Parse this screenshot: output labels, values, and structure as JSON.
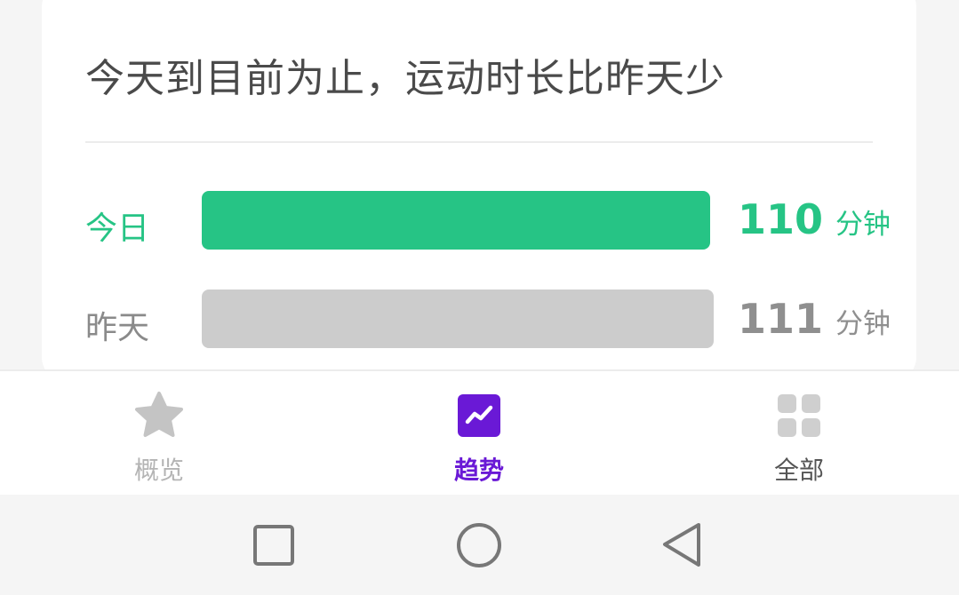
{
  "card": {
    "headline": "今天到目前为止，运动时长比昨天少",
    "rows": [
      {
        "label": "今日",
        "value": "110",
        "unit": "分钟",
        "color": "#26c485"
      },
      {
        "label": "昨天",
        "value": "111",
        "unit": "分钟",
        "color": "#cccccc"
      }
    ]
  },
  "tabbar": {
    "tabs": [
      {
        "label": "概览",
        "icon": "star-icon",
        "active": false
      },
      {
        "label": "趋势",
        "icon": "trend-icon",
        "active": true
      },
      {
        "label": "全部",
        "icon": "grid-icon",
        "active": false
      }
    ],
    "active_color": "#6a19d6"
  },
  "navbar": {
    "buttons": [
      "recent-apps-icon",
      "home-icon",
      "back-icon"
    ]
  }
}
